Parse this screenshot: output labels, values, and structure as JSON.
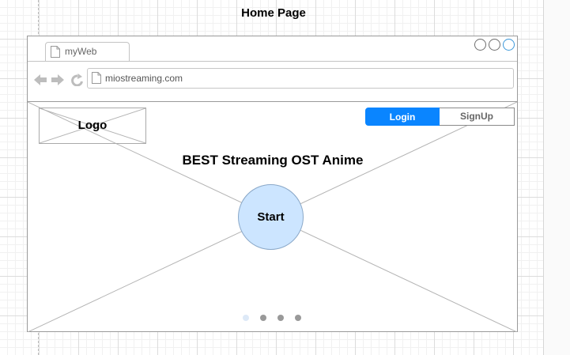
{
  "page_title": "Home Page",
  "browser": {
    "tab_label": "myWeb",
    "address": "miostreaming.com"
  },
  "header": {
    "logo_label": "Logo",
    "login_label": "Login",
    "signup_label": "SignUp"
  },
  "hero": {
    "headline": "BEST Streaming OST Anime",
    "start_label": "Start"
  },
  "carousel": {
    "count": 4,
    "active_index": 0
  },
  "colors": {
    "accent": "#0a85ff",
    "start_fill": "#cce5ff",
    "active_dot": "#dde9f7",
    "inactive_dot": "#999999"
  }
}
